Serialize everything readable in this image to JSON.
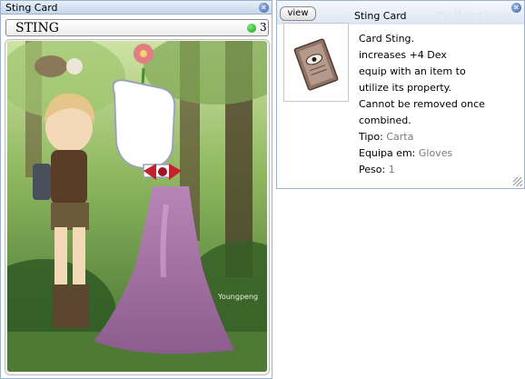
{
  "card_window": {
    "title": "Sting Card",
    "card_name": "STING",
    "slot_count": "3",
    "artist_signature": "Youngpeng"
  },
  "desc_window": {
    "view_label": "view",
    "title": "Sting Card",
    "watermark": "Collections",
    "description_lines": [
      "Card Sting.",
      "increases +4 Dex",
      "equip with an item to",
      "utilize its property.",
      "Cannot be removed once",
      "combined."
    ],
    "properties": [
      {
        "label": "Tipo:",
        "value": "Carta"
      },
      {
        "label": "Equipa em:",
        "value": "Gloves"
      },
      {
        "label": "Peso:",
        "value": "1"
      }
    ]
  },
  "icons": {
    "close": "close-icon",
    "slot": "slot-green-dot-icon",
    "card": "card-eye-icon",
    "grip": "resize-grip-icon"
  },
  "colors": {
    "window_border": "#9cb2cc",
    "slot_green": "#14a014",
    "property_value": "#7a7a7a",
    "close_button": "#3f64a6"
  }
}
